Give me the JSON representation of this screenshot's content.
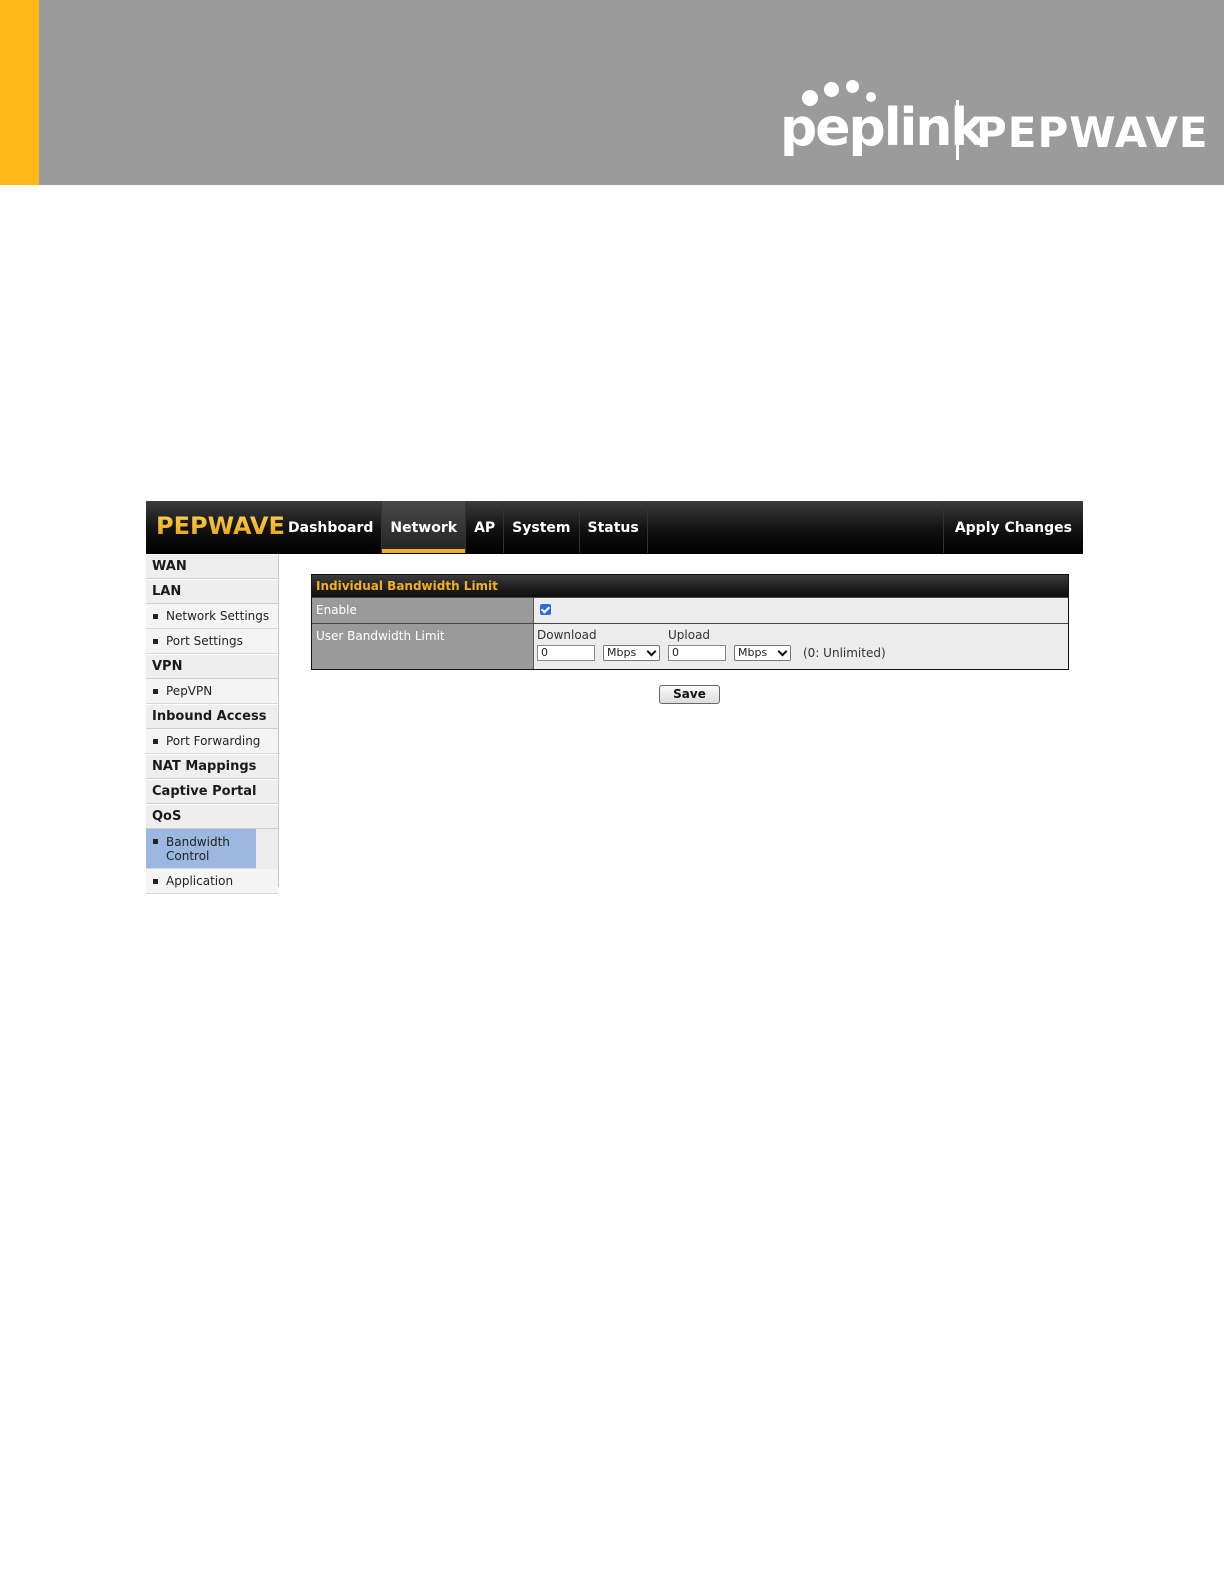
{
  "doc_header": {
    "brand_left": "peplink",
    "brand_right": "PEPWAVE",
    "colors": {
      "band": "#9b9b9b",
      "accent": "#fdb719"
    }
  },
  "app": {
    "logo": "PEPWAVE",
    "nav": [
      "Dashboard",
      "Network",
      "AP",
      "System",
      "Status"
    ],
    "active_tab": "Network",
    "apply_label": "Apply Changes",
    "accent": "#f2b01e"
  },
  "sidebar": {
    "wan": "WAN",
    "lan": "LAN",
    "lan_items": [
      "Network Settings",
      "Port Settings"
    ],
    "vpn": "VPN",
    "vpn_items": [
      "PepVPN"
    ],
    "inbound": "Inbound Access",
    "inbound_items": [
      "Port Forwarding"
    ],
    "nat": "NAT Mappings",
    "captive": "Captive Portal",
    "qos": "QoS",
    "qos_items": [
      "Bandwidth Control",
      "Application"
    ]
  },
  "panel": {
    "title": "Individual Bandwidth Limit",
    "enable_label": "Enable",
    "enable_checked": true,
    "limit_label": "User Bandwidth Limit",
    "download_label": "Download",
    "upload_label": "Upload",
    "download_value": "0",
    "download_unit": "Mbps",
    "upload_value": "0",
    "upload_unit": "Mbps",
    "hint": "(0: Unlimited)"
  },
  "save_label": "Save"
}
